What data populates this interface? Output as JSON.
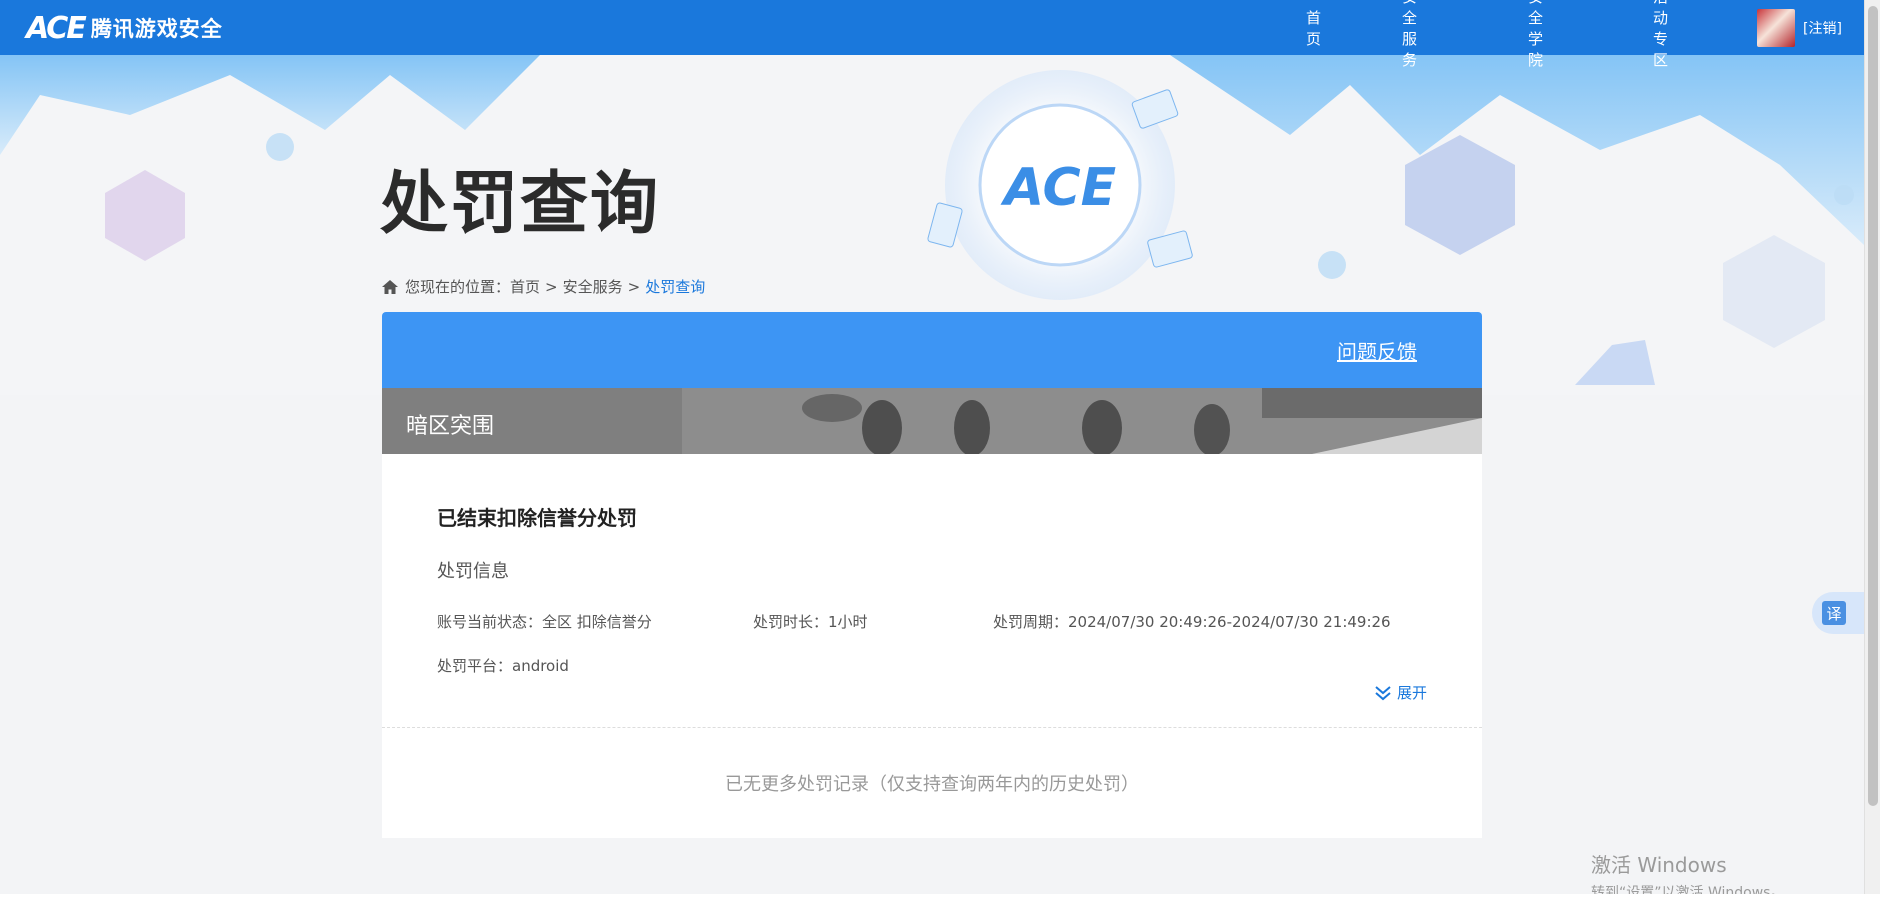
{
  "header": {
    "logo_mark": "ACE",
    "logo_text": "腾讯游戏安全",
    "nav": [
      "首页",
      "安全服务",
      "安全学院",
      "活动专区"
    ],
    "logout": "[注销]"
  },
  "hero": {
    "title": "处罚查询"
  },
  "breadcrumb": {
    "prefix": "您现在的位置：",
    "items": [
      "首页",
      "安全服务",
      "处罚查询"
    ],
    "separator": ">"
  },
  "card": {
    "feedback": "问题反馈",
    "game_name": "暗区突围",
    "status_title": "已结束扣除信誉分处罚",
    "info_title": "处罚信息",
    "account_status": "账号当前状态：全区 扣除信誉分",
    "duration": "处罚时长：1小时",
    "period": "处罚周期：2024/07/30 20:49:26-2024/07/30 21:49:26",
    "platform": "处罚平台：android",
    "expand": "展开",
    "no_more": "已无更多处罚记录（仅支持查询两年内的历史处罚）"
  },
  "translate": "译",
  "watermark": {
    "line1": "激活 Windows",
    "line2": "转到“设置”以激活 Windows。"
  },
  "colors": {
    "nav_bg": "#1a78dc",
    "card_header": "#3d95f4",
    "accent": "#1a78dc"
  }
}
